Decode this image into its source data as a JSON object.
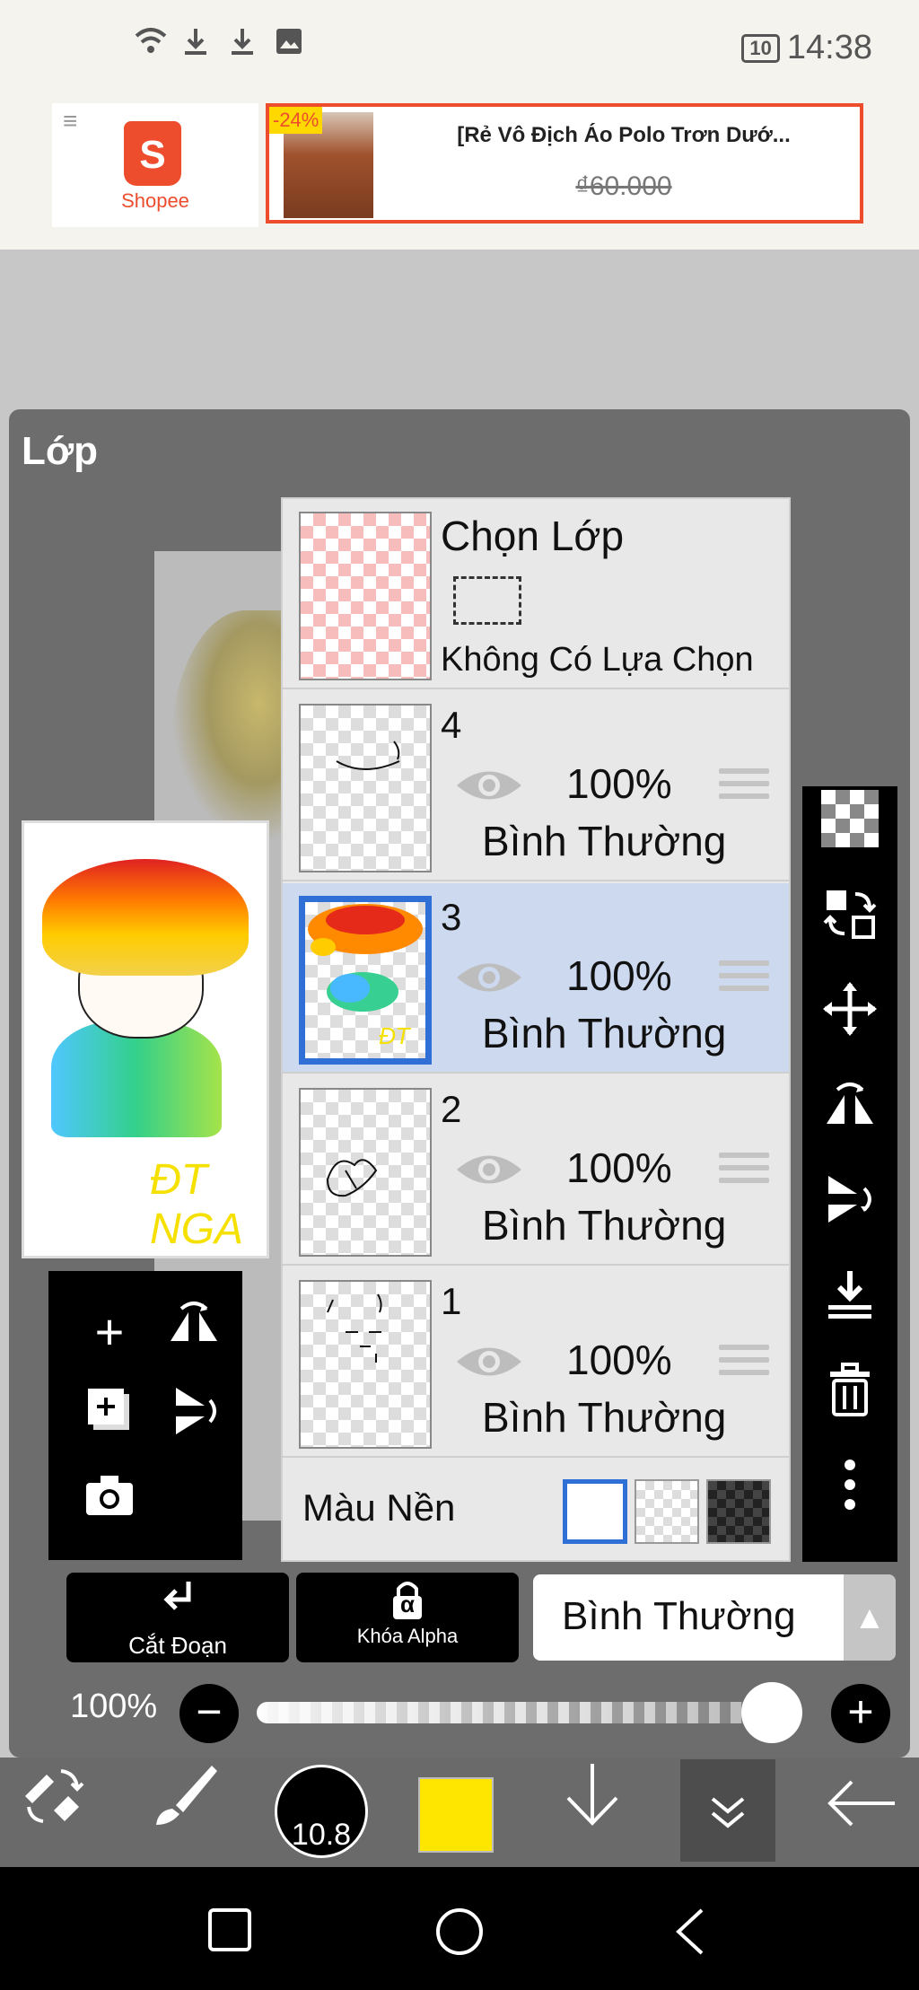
{
  "status_bar": {
    "battery": "10",
    "time": "14:38"
  },
  "ad": {
    "brand": "Shopee",
    "discount": "-24%",
    "title": "[Rẻ Vô Địch Áo Polo Trơn Dướ...",
    "price": "₫60.000"
  },
  "panel": {
    "title": "Lớp"
  },
  "preview": {
    "signature": "ĐT NGA"
  },
  "select_layer": {
    "title": "Chọn Lớp",
    "subtitle": "Không Có Lựa Chọn"
  },
  "layers": [
    {
      "number": "4",
      "opacity": "100%",
      "blend": "Bình Thường",
      "selected": false
    },
    {
      "number": "3",
      "opacity": "100%",
      "blend": "Bình Thường",
      "selected": true
    },
    {
      "number": "2",
      "opacity": "100%",
      "blend": "Bình Thường",
      "selected": false
    },
    {
      "number": "1",
      "opacity": "100%",
      "blend": "Bình Thường",
      "selected": false
    }
  ],
  "background": {
    "label": "Màu Nền",
    "options": [
      "white",
      "transparent",
      "dark-checker"
    ],
    "selected": "white"
  },
  "buttons": {
    "clip": "Cắt Đoạn",
    "alpha_lock": "Khóa Alpha",
    "alpha_symbol": "α",
    "blend_mode": "Bình Thường"
  },
  "opacity_slider": {
    "label": "100%",
    "value": 1.0
  },
  "toolbar": {
    "brush_size": "10.8",
    "color": "#ffe600"
  },
  "colors": {
    "selected_layer": "#cdd9ee",
    "accent": "#2f6fd6",
    "shopee": "#ee4d2d"
  }
}
